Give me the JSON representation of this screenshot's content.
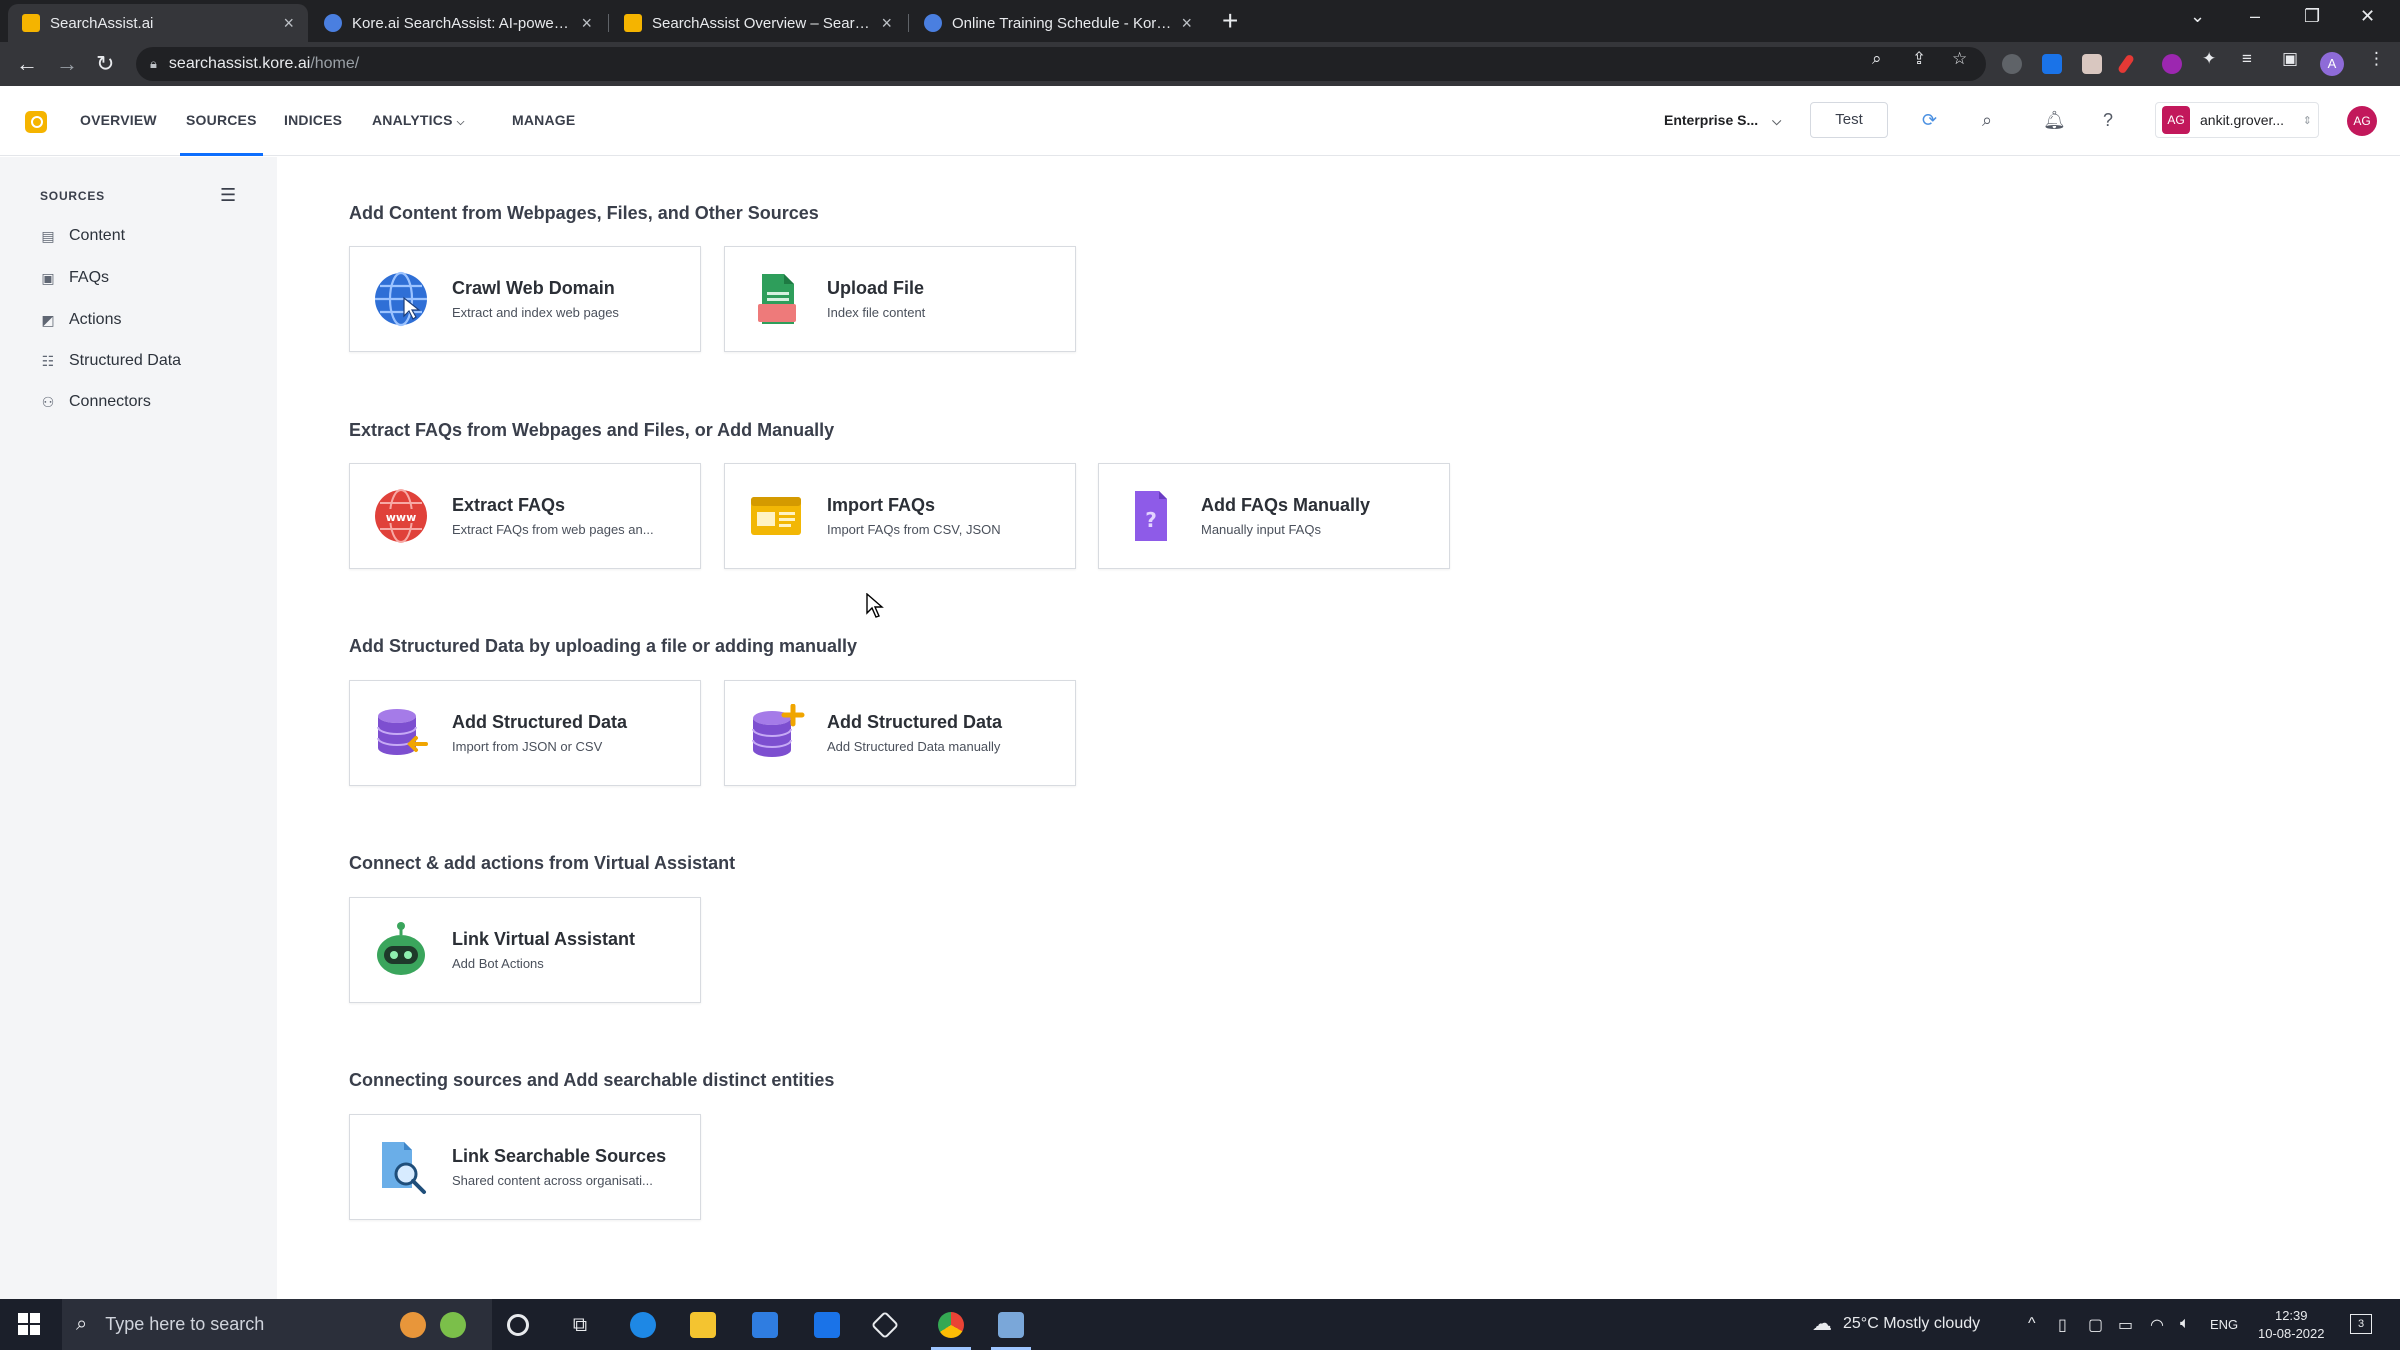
{
  "browser": {
    "tabs": [
      {
        "title": "SearchAssist.ai",
        "favicon_color": "#f5b400"
      },
      {
        "title": "Kore.ai SearchAssist: AI-powered",
        "favicon_color": "#4a7fe0"
      },
      {
        "title": "SearchAssist Overview – SearchA",
        "favicon_color": "#f5b400"
      },
      {
        "title": "Online Training Schedule - Kore.a",
        "favicon_color": "#4a7fe0"
      }
    ],
    "url_host": "searchassist.kore.ai",
    "url_path": "/home/",
    "profile_initial": "A"
  },
  "app": {
    "nav": [
      {
        "label": "OVERVIEW"
      },
      {
        "label": "SOURCES"
      },
      {
        "label": "INDICES"
      },
      {
        "label": "ANALYTICS"
      },
      {
        "label": "MANAGE"
      }
    ],
    "environment": "Enterprise S...",
    "test_button": "Test",
    "user_initials": "AG",
    "user_name": "ankit.grover...",
    "accent": "#0d6efd"
  },
  "sidebar": {
    "title": "SOURCES",
    "items": [
      {
        "label": "Content",
        "icon": "document-icon"
      },
      {
        "label": "FAQs",
        "icon": "faq-icon"
      },
      {
        "label": "Actions",
        "icon": "actions-icon"
      },
      {
        "label": "Structured Data",
        "icon": "table-icon"
      },
      {
        "label": "Connectors",
        "icon": "connector-icon"
      }
    ]
  },
  "sections": [
    {
      "title": "Add Content from Webpages, Files, and Other Sources"
    },
    {
      "title": "Extract FAQs from Webpages and Files, or Add Manually"
    },
    {
      "title": "Add Structured Data by uploading a file or adding manually"
    },
    {
      "title": "Connect & add actions from Virtual Assistant"
    },
    {
      "title": "Connecting sources and Add searchable distinct entities"
    }
  ],
  "cards": {
    "crawl": {
      "title": "Crawl Web Domain",
      "subtitle": "Extract and index web pages",
      "icon": "globe-icon"
    },
    "upload": {
      "title": "Upload File",
      "subtitle": "Index file content",
      "icon": "file-upload-icon"
    },
    "extract_faqs": {
      "title": "Extract FAQs",
      "subtitle": "Extract FAQs from web pages an...",
      "icon": "www-globe-icon"
    },
    "import_faqs": {
      "title": "Import FAQs",
      "subtitle": "Import FAQs from CSV, JSON",
      "icon": "import-window-icon"
    },
    "add_faqs": {
      "title": "Add FAQs Manually",
      "subtitle": "Manually input FAQs",
      "icon": "question-doc-icon"
    },
    "sd_import": {
      "title": "Add Structured Data",
      "subtitle": "Import from JSON or CSV",
      "icon": "database-import-icon"
    },
    "sd_manual": {
      "title": "Add Structured Data",
      "subtitle": "Add Structured Data manually",
      "icon": "database-add-icon"
    },
    "link_va": {
      "title": "Link Virtual Assistant",
      "subtitle": "Add Bot Actions",
      "icon": "robot-icon"
    },
    "link_sources": {
      "title": "Link Searchable Sources",
      "subtitle": "Shared content across organisati...",
      "icon": "doc-search-icon"
    }
  },
  "taskbar": {
    "search_placeholder": "Type here to search",
    "weather": "25°C  Mostly cloudy",
    "lang": "ENG",
    "time": "12:39",
    "date": "10-08-2022",
    "notifications": "3"
  }
}
